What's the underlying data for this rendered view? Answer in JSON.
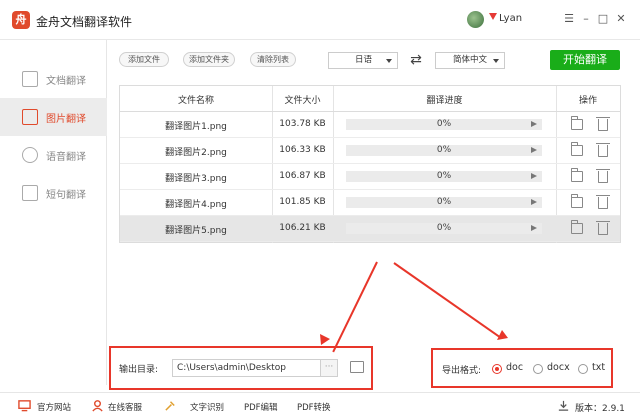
{
  "app": {
    "title": "金舟文档翻译软件",
    "logo_text": "舟"
  },
  "user": {
    "name": "Lyan"
  },
  "window": {
    "minimize": "–",
    "maximize": "□",
    "close": "✕",
    "menu": "☰"
  },
  "sidebar": {
    "items": [
      {
        "label": "文档翻译",
        "icon": "document-icon",
        "active": false
      },
      {
        "label": "图片翻译",
        "icon": "image-icon",
        "active": true
      },
      {
        "label": "语音翻译",
        "icon": "microphone-icon",
        "active": false
      },
      {
        "label": "短句翻译",
        "icon": "text-icon",
        "active": false
      }
    ]
  },
  "toolbar": {
    "add_file": "添加文件",
    "add_folder": "添加文件夹",
    "clear_list": "清除列表",
    "source_lang": "日语",
    "target_lang": "简体中文",
    "swap_icon": "⇄",
    "start_label": "开始翻译"
  },
  "table": {
    "headers": [
      "文件名称",
      "文件大小",
      "翻译进度",
      "操作"
    ],
    "rows": [
      {
        "name": "翻译图片1.png",
        "size": "103.78 KB",
        "progress_text": "0%",
        "progress": 0
      },
      {
        "name": "翻译图片2.png",
        "size": "106.33 KB",
        "progress_text": "0%",
        "progress": 0
      },
      {
        "name": "翻译图片3.png",
        "size": "106.87 KB",
        "progress_text": "0%",
        "progress": 0
      },
      {
        "name": "翻译图片4.png",
        "size": "101.85 KB",
        "progress_text": "0%",
        "progress": 0
      },
      {
        "name": "翻译图片5.png",
        "size": "106.21 KB",
        "progress_text": "0%",
        "progress": 0
      }
    ]
  },
  "output": {
    "label": "输出目录:",
    "path": "C:\\Users\\admin\\Desktop",
    "browse_label": "···"
  },
  "export": {
    "label": "导出格式:",
    "options": [
      {
        "label": "doc",
        "checked": true
      },
      {
        "label": "docx",
        "checked": false
      },
      {
        "label": "txt",
        "checked": false
      }
    ]
  },
  "footer": {
    "website": "官方网站",
    "support": "在线客服",
    "ocr": "文字识别",
    "pdf_edit": "PDF编辑",
    "pdf_convert": "PDF转换",
    "version": "版本：2.9.1"
  },
  "colors": {
    "accent": "#e04a2c",
    "start": "#1aad19",
    "highlight": "#e8362a"
  }
}
